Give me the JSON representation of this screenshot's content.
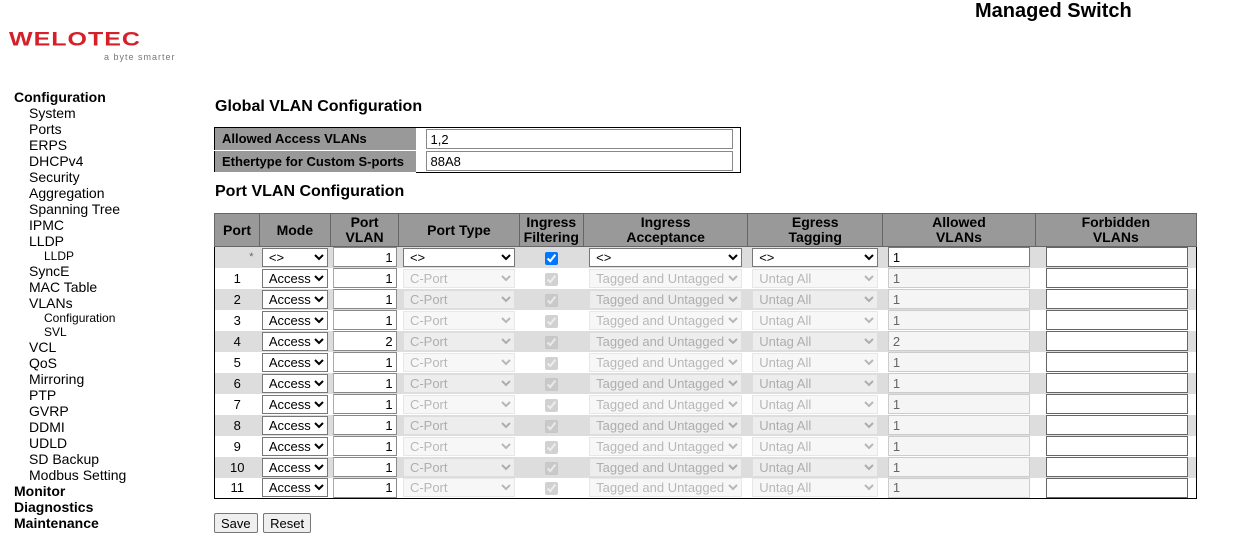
{
  "header": {
    "logo_text": "WELOTEC",
    "logo_tagline": "a byte smarter",
    "app_title": "Managed Switch"
  },
  "nav": {
    "configuration": "Configuration",
    "config_items": [
      "System",
      "Ports",
      "ERPS",
      "DHCPv4",
      "Security",
      "Aggregation",
      "Spanning Tree",
      "IPMC",
      "LLDP"
    ],
    "lldp_sub": "LLDP",
    "config_items2": [
      "SyncE",
      "MAC Table",
      "VLANs"
    ],
    "vlans_sub": [
      "Configuration",
      "SVL"
    ],
    "config_items3": [
      "VCL",
      "QoS",
      "Mirroring",
      "PTP",
      "GVRP",
      "DDMI",
      "UDLD",
      "SD Backup",
      "Modbus Setting"
    ],
    "monitor": "Monitor",
    "diagnostics": "Diagnostics",
    "maintenance": "Maintenance"
  },
  "global": {
    "title": "Global VLAN Configuration",
    "allowed_access_label": "Allowed Access VLANs",
    "allowed_access_value": "1,2",
    "ethertype_label": "Ethertype for Custom S-ports",
    "ethertype_value": "88A8"
  },
  "port_config": {
    "title": "Port VLAN Configuration",
    "headers": {
      "port": "Port",
      "mode": "Mode",
      "port_vlan_1": "Port",
      "port_vlan_2": "VLAN",
      "port_type": "Port Type",
      "ingress_filtering_1": "Ingress",
      "ingress_filtering_2": "Filtering",
      "ingress_acceptance_1": "Ingress",
      "ingress_acceptance_2": "Acceptance",
      "egress_tagging_1": "Egress",
      "egress_tagging_2": "Tagging",
      "allowed_vlans_1": "Allowed",
      "allowed_vlans_2": "VLANs",
      "forbidden_vlans_1": "Forbidden",
      "forbidden_vlans_2": "VLANs"
    },
    "star_row": {
      "port": "*",
      "mode": "<>",
      "port_vlan": "1",
      "port_type": "<>",
      "ingress_filtering": true,
      "ingress_acceptance": "<>",
      "egress_tagging": "<>",
      "allowed_vlans": "1",
      "forbidden_vlans": ""
    },
    "rows": [
      {
        "port": "1",
        "mode": "Access",
        "port_vlan": "1",
        "port_type": "C-Port",
        "ingress_filtering": true,
        "ingress_acceptance": "Tagged and Untagged",
        "egress_tagging": "Untag All",
        "allowed_vlans": "1",
        "forbidden_vlans": ""
      },
      {
        "port": "2",
        "mode": "Access",
        "port_vlan": "1",
        "port_type": "C-Port",
        "ingress_filtering": true,
        "ingress_acceptance": "Tagged and Untagged",
        "egress_tagging": "Untag All",
        "allowed_vlans": "1",
        "forbidden_vlans": ""
      },
      {
        "port": "3",
        "mode": "Access",
        "port_vlan": "1",
        "port_type": "C-Port",
        "ingress_filtering": true,
        "ingress_acceptance": "Tagged and Untagged",
        "egress_tagging": "Untag All",
        "allowed_vlans": "1",
        "forbidden_vlans": ""
      },
      {
        "port": "4",
        "mode": "Access",
        "port_vlan": "2",
        "port_type": "C-Port",
        "ingress_filtering": true,
        "ingress_acceptance": "Tagged and Untagged",
        "egress_tagging": "Untag All",
        "allowed_vlans": "2",
        "forbidden_vlans": ""
      },
      {
        "port": "5",
        "mode": "Access",
        "port_vlan": "1",
        "port_type": "C-Port",
        "ingress_filtering": true,
        "ingress_acceptance": "Tagged and Untagged",
        "egress_tagging": "Untag All",
        "allowed_vlans": "1",
        "forbidden_vlans": ""
      },
      {
        "port": "6",
        "mode": "Access",
        "port_vlan": "1",
        "port_type": "C-Port",
        "ingress_filtering": true,
        "ingress_acceptance": "Tagged and Untagged",
        "egress_tagging": "Untag All",
        "allowed_vlans": "1",
        "forbidden_vlans": ""
      },
      {
        "port": "7",
        "mode": "Access",
        "port_vlan": "1",
        "port_type": "C-Port",
        "ingress_filtering": true,
        "ingress_acceptance": "Tagged and Untagged",
        "egress_tagging": "Untag All",
        "allowed_vlans": "1",
        "forbidden_vlans": ""
      },
      {
        "port": "8",
        "mode": "Access",
        "port_vlan": "1",
        "port_type": "C-Port",
        "ingress_filtering": true,
        "ingress_acceptance": "Tagged and Untagged",
        "egress_tagging": "Untag All",
        "allowed_vlans": "1",
        "forbidden_vlans": ""
      },
      {
        "port": "9",
        "mode": "Access",
        "port_vlan": "1",
        "port_type": "C-Port",
        "ingress_filtering": true,
        "ingress_acceptance": "Tagged and Untagged",
        "egress_tagging": "Untag All",
        "allowed_vlans": "1",
        "forbidden_vlans": ""
      },
      {
        "port": "10",
        "mode": "Access",
        "port_vlan": "1",
        "port_type": "C-Port",
        "ingress_filtering": true,
        "ingress_acceptance": "Tagged and Untagged",
        "egress_tagging": "Untag All",
        "allowed_vlans": "1",
        "forbidden_vlans": ""
      },
      {
        "port": "11",
        "mode": "Access",
        "port_vlan": "1",
        "port_type": "C-Port",
        "ingress_filtering": true,
        "ingress_acceptance": "Tagged and Untagged",
        "egress_tagging": "Untag All",
        "allowed_vlans": "1",
        "forbidden_vlans": ""
      }
    ]
  },
  "buttons": {
    "save": "Save",
    "reset": "Reset"
  }
}
